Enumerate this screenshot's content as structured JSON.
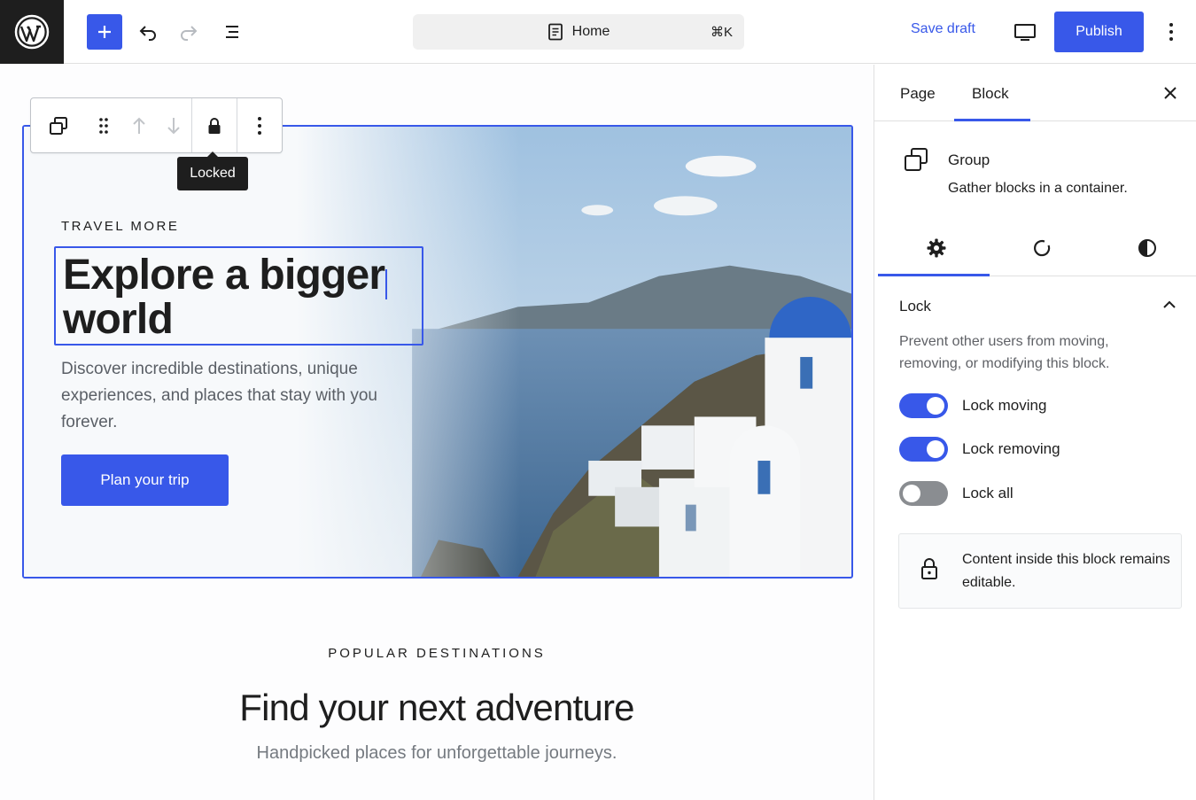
{
  "topbar": {
    "logo_icon": "wordpress-logo-icon",
    "add_icon": "plus-icon",
    "undo_icon": "undo-icon",
    "redo_icon": "redo-icon",
    "outline_icon": "document-overview-icon",
    "command_bar": {
      "label": "Home",
      "shortcut": "⌘K",
      "icon": "page-icon"
    },
    "save_draft": "Save draft",
    "view_icon": "desktop-preview-icon",
    "publish": "Publish",
    "options_icon": "more-vertical-icon"
  },
  "canvas": {
    "block_toolbar": {
      "items": [
        "group-icon",
        "drag-handle-icon",
        "move-up-icon",
        "move-down-icon",
        "lock-icon",
        "more-vertical-icon"
      ],
      "tooltip": "Locked"
    },
    "hero": {
      "eyebrow": "TRAVEL MORE",
      "heading_line1": "Explore a bigger",
      "heading_line2": "world",
      "description": "Discover incredible destinations, unique experiences, and places that stay with you forever.",
      "cta": "Plan your trip"
    },
    "popular": {
      "eyebrow": "POPULAR DESTINATIONS",
      "title": "Find your next adventure",
      "subtitle": "Handpicked places for unforgettable journeys."
    }
  },
  "sidebar": {
    "tabs": [
      "Page",
      "Block"
    ],
    "active_tab": "Block",
    "block": {
      "name": "Group",
      "description": "Gather blocks in a container."
    },
    "subtabs": [
      "settings-icon",
      "styles-icon",
      "contrast-icon"
    ],
    "lock": {
      "title": "Lock",
      "help": "Prevent other users from moving, removing, or modifying this block.",
      "toggles": [
        {
          "label": "Lock moving",
          "on": true
        },
        {
          "label": "Lock removing",
          "on": true
        },
        {
          "label": "Lock all",
          "on": false
        }
      ],
      "notice": "Content inside this block remains editable."
    }
  },
  "colors": {
    "accent": "#3858e9",
    "dark": "#1e1e1e",
    "muted": "#757a80"
  }
}
